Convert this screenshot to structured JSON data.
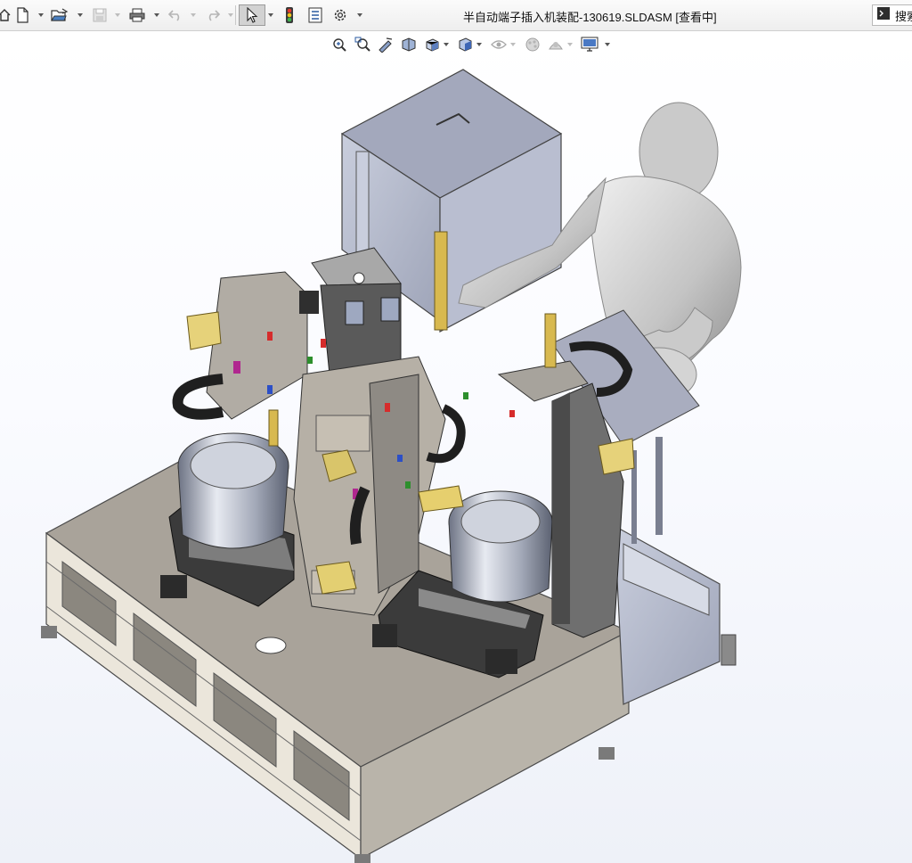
{
  "window": {
    "title": "半自动端子插入机装配-130619.SLDASM [查看中]"
  },
  "toolbar": {
    "items": [
      {
        "name": "home-icon",
        "type": "button"
      },
      {
        "name": "new-document-icon",
        "type": "button"
      },
      {
        "name": "new-dropdown",
        "type": "dropdown"
      },
      {
        "name": "open-folder-icon",
        "type": "button"
      },
      {
        "name": "open-dropdown",
        "type": "dropdown"
      },
      {
        "name": "save-icon",
        "type": "button",
        "disabled": true
      },
      {
        "name": "save-dropdown",
        "type": "dropdown",
        "disabled": true
      },
      {
        "name": "print-icon",
        "type": "button"
      },
      {
        "name": "print-dropdown",
        "type": "dropdown"
      },
      {
        "name": "undo-icon",
        "type": "button",
        "disabled": true
      },
      {
        "name": "undo-dropdown",
        "type": "dropdown",
        "disabled": true
      },
      {
        "name": "redo-icon",
        "type": "button",
        "disabled": true
      },
      {
        "name": "redo-dropdown",
        "type": "dropdown",
        "disabled": true
      },
      {
        "name": "select-cursor-icon",
        "type": "button",
        "active": true
      },
      {
        "name": "select-dropdown",
        "type": "dropdown"
      },
      {
        "name": "rebuild-traffic-light-icon",
        "type": "button"
      },
      {
        "name": "file-properties-icon",
        "type": "button"
      },
      {
        "name": "options-gear-icon",
        "type": "button"
      },
      {
        "name": "options-dropdown",
        "type": "dropdown"
      }
    ]
  },
  "search": {
    "prompt_icon": "command-prompt-icon",
    "text": "搜索"
  },
  "view_toolbar": {
    "items": [
      "zoom-to-fit-icon",
      "zoom-to-area-icon",
      "previous-view-icon",
      "section-view-icon",
      "view-orientation-icon",
      "display-style-icon",
      "hide-show-items-icon",
      "edit-appearance-icon",
      "apply-scene-icon",
      "view-settings-icon"
    ]
  },
  "colors": {
    "toolbar_bg": "#f2f2f2",
    "active_tool": "#d2d2d2",
    "viewport_bg": "#f4f6fb",
    "model_gray": "#a7a39c",
    "frame_light": "#e8e4da",
    "cabinet_blue": "#b2b8cc",
    "mannequin": "#c8c8c8",
    "bowl_steel": "#9aa2b2",
    "bracket_yellow": "#e6d27a",
    "dark_part": "#3d3d3d"
  },
  "viewport": {
    "content": "3d-assembly-model"
  }
}
